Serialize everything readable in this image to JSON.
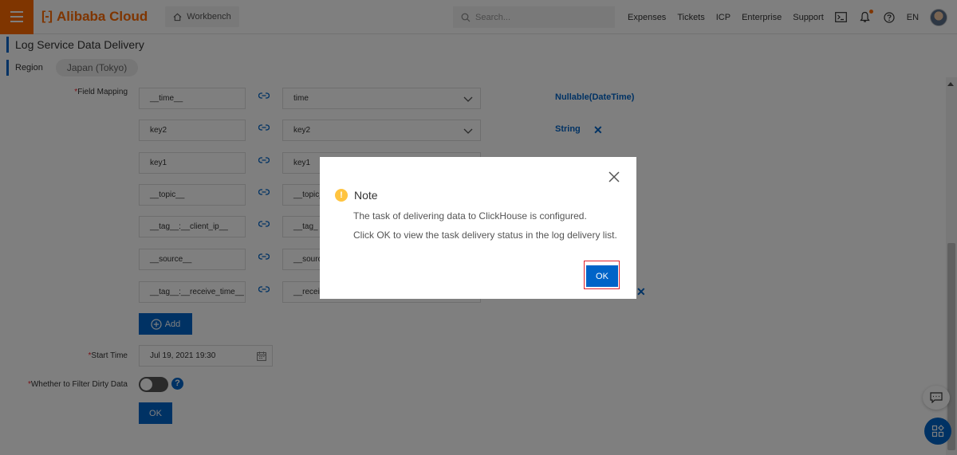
{
  "topbar": {
    "logo_text": "Alibaba Cloud",
    "workbench_label": "Workbench",
    "search_placeholder": "Search...",
    "nav": [
      "Expenses",
      "Tickets",
      "ICP",
      "Enterprise",
      "Support"
    ],
    "language": "EN"
  },
  "page": {
    "title": "Log Service Data Delivery",
    "region_label": "Region",
    "region_value": "Japan (Tokyo)"
  },
  "form": {
    "field_mapping_label": "Field Mapping",
    "mappings": [
      {
        "source": "__time__",
        "target": "time",
        "type": "Nullable(DateTime)"
      },
      {
        "source": "key2",
        "target": "key2",
        "type": "String"
      },
      {
        "source": "key1",
        "target": "key1",
        "type": ""
      },
      {
        "source": "__topic__",
        "target": "__topic_",
        "type": ""
      },
      {
        "source": "__tag__:__client_ip__",
        "target": "__tag_",
        "type": ""
      },
      {
        "source": "__source__",
        "target": "__sourc",
        "type": ""
      },
      {
        "source": "__tag__:__receive_time__",
        "target": "__receiv",
        "type": ""
      }
    ],
    "add_label": "Add",
    "start_time_label": "Start Time",
    "start_time_value": "Jul 19, 2021 19:30",
    "filter_dirty_label": "Whether to Filter Dirty Data",
    "filter_dirty_enabled": false,
    "ok_label": "OK",
    "required_mark": "*"
  },
  "dialog": {
    "title": "Note",
    "line1": "The task of delivering data to ClickHouse is configured.",
    "line2": "Click OK to view the task delivery status in the log delivery list.",
    "ok_label": "OK"
  },
  "colors": {
    "brand_orange": "#ff6a00",
    "primary_blue": "#0064c8",
    "highlight_red": "#e0202a",
    "warning_yellow": "#ffc440"
  }
}
